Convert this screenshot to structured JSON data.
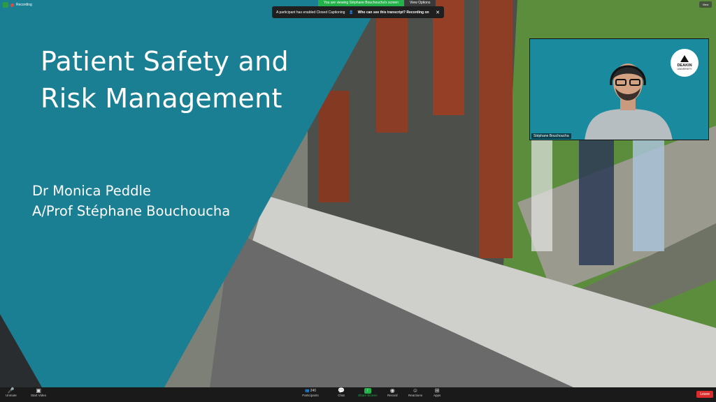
{
  "top_bar": {
    "recording_label": "Recording",
    "viewing_text": "You are viewing Stéphane Bouchoucha's screen",
    "view_options_label": "View Options",
    "view_button": "View"
  },
  "caption_banner": {
    "message": "A participant has enabled Closed Captioning",
    "question": "Who can see this transcript? Recording on"
  },
  "slide": {
    "title_line1": "Patient Safety and",
    "title_line2": "Risk Management",
    "author1": "Dr Monica Peddle",
    "author2": "A/Prof Stéphane Bouchoucha",
    "teal_color": "#1b7f93"
  },
  "video": {
    "participant_name": "Stéphane Bouchoucha",
    "logo_line1": "DEAKIN",
    "logo_line2": "UNIVERSITY"
  },
  "toolbar": {
    "unmute": "Unmute",
    "start_video": "Start Video",
    "participants": "Participants",
    "participants_count": "240",
    "chat": "Chat",
    "share_screen": "Share Screen",
    "record": "Record",
    "reactions": "Reactions",
    "apps": "Apps",
    "leave": "Leave"
  }
}
